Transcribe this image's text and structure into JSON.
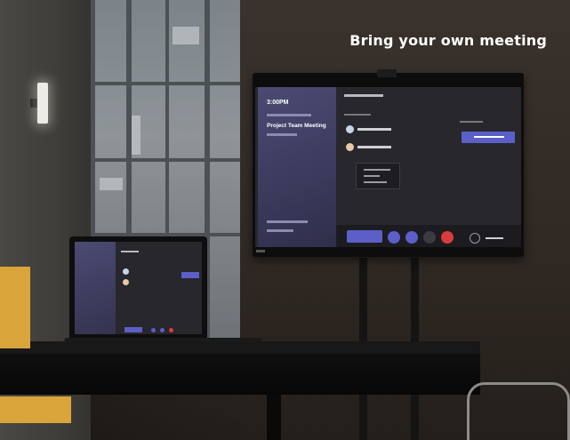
{
  "heading": "Bring your own meeting",
  "tv": {
    "time": "3:00PM",
    "meeting_title": "Project Team Meeting"
  },
  "colors": {
    "accent": "#5b5fc7",
    "side_panel": "#3b3a5c",
    "chair": "#d9a53b",
    "hangup": "#d93c3c"
  },
  "icons": [
    "camera-icon",
    "microphone-icon",
    "share-icon",
    "hangup-icon",
    "volume-icon"
  ]
}
